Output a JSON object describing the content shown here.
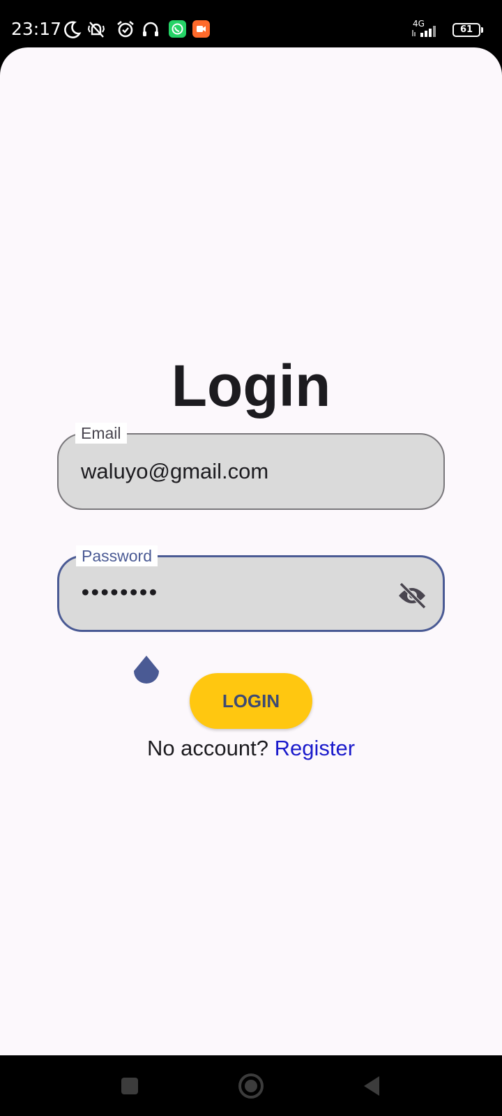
{
  "status_bar": {
    "time": "23:17",
    "network_type": "4G",
    "battery_level": "61",
    "icons": [
      "moon-icon",
      "vibrate-off-icon",
      "alarm-icon",
      "headset-icon",
      "whatsapp-icon",
      "video-app-icon",
      "signal-icon",
      "battery-icon"
    ],
    "whatsapp_color": "#25d366",
    "video_app_color": "#ff6a2b"
  },
  "login": {
    "title": "Login",
    "email": {
      "label": "Email",
      "value": "waluyo@gmail.com"
    },
    "password": {
      "label": "Password",
      "value": "••••••••",
      "toggle_icon": "eye-off-icon"
    },
    "button_label": "LOGIN",
    "no_account_text": "No account? ",
    "register_link": "Register"
  },
  "colors": {
    "background": "#fcf8fc",
    "field_fill": "#dadada",
    "focus_accent": "#4a5a94",
    "button": "#ffc710",
    "link": "#1a1acb"
  },
  "nav_bar": {
    "icons": [
      "recents-square-icon",
      "home-circle-icon",
      "back-triangle-icon"
    ]
  }
}
